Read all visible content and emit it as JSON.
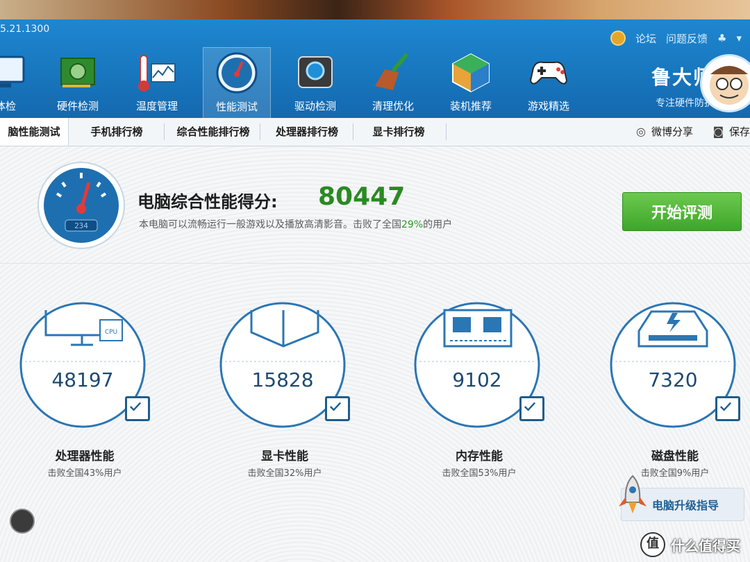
{
  "app": {
    "version": "5.21.1300"
  },
  "header": {
    "links": [
      "论坛",
      "问题反馈"
    ],
    "brand_name": "鲁大师",
    "brand_slogan": "专注硬件防护",
    "nav": [
      {
        "label": "体检",
        "icon": "monitor-icon"
      },
      {
        "label": "硬件检测",
        "icon": "circuit-board-icon"
      },
      {
        "label": "温度管理",
        "icon": "thermometer-icon"
      },
      {
        "label": "性能测试",
        "icon": "speedometer-icon",
        "active": true
      },
      {
        "label": "驱动检测",
        "icon": "gear-chip-icon"
      },
      {
        "label": "清理优化",
        "icon": "broom-icon"
      },
      {
        "label": "装机推荐",
        "icon": "cube-icon"
      },
      {
        "label": "游戏精选",
        "icon": "gamepad-icon"
      }
    ]
  },
  "tabs": {
    "items": [
      "脑性能测试",
      "手机排行榜",
      "综合性能排行榜",
      "处理器排行榜",
      "显卡排行榜"
    ],
    "share_label": "微博分享",
    "save_label": "保存"
  },
  "summary": {
    "title": "电脑综合性能得分:",
    "score": "80447",
    "desc_prefix": "本电脑可以流畅运行一般游戏以及播放高清影音。击败了全国",
    "desc_pct": "29%",
    "desc_suffix": "的用户",
    "gauge_readout": "234",
    "start_button": "开始评测"
  },
  "metrics": [
    {
      "name": "处理器性能",
      "value": "48197",
      "sub": "击败全国43%用户",
      "icon": "cpu-monitor-icon"
    },
    {
      "name": "显卡性能",
      "value": "15828",
      "sub": "击败全国32%用户",
      "icon": "graphics-cube-icon"
    },
    {
      "name": "内存性能",
      "value": "9102",
      "sub": "击败全国53%用户",
      "icon": "memory-chip-icon"
    },
    {
      "name": "磁盘性能",
      "value": "7320",
      "sub": "击败全国9%用户",
      "icon": "disk-drive-icon"
    }
  ],
  "footer": {
    "upgrade_label": "电脑升级指导",
    "watermark_badge": "值",
    "watermark_text": "什么值得买"
  },
  "colors": {
    "header_blue": "#1774bb",
    "score_green": "#2a8a22",
    "button_green": "#3ea62a",
    "metric_blue": "#1d4a72"
  }
}
